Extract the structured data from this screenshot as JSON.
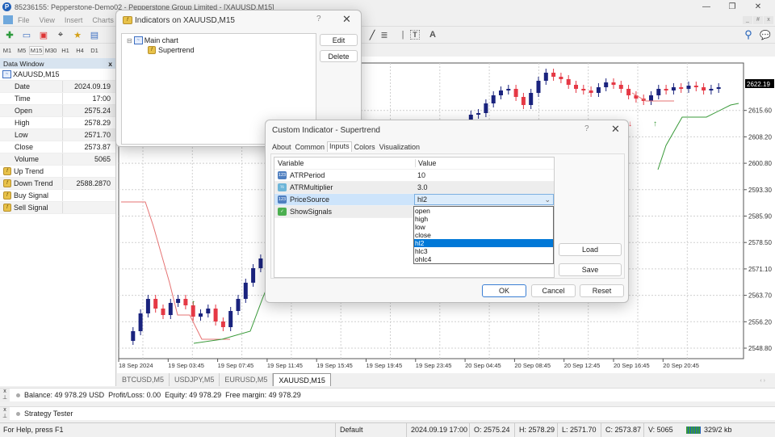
{
  "window": {
    "title": "85236155: Pepperstone-Demo02 - Pepperstone Group Limited - [XAUUSD,M15]",
    "logo": "P",
    "controls": {
      "minimize": "—",
      "restore": "❐",
      "close": "✕"
    }
  },
  "menu": [
    "File",
    "View",
    "Insert",
    "Charts"
  ],
  "mdi_controls": [
    "_",
    "#",
    "x"
  ],
  "toolbar": {
    "icons": [
      "new-chart-icon",
      "profiles-icon",
      "market-watch-icon",
      "crosshair-icon",
      "favorites-icon",
      "navigator-icon"
    ],
    "right_icons": [
      "line-icon",
      "fibonacci-icon",
      "vertical-line-icon",
      "text-icon",
      "text-label-icon"
    ],
    "glyphs": {
      "trendline": "╱",
      "fibo": "≣",
      "vline": "|",
      "text": "T",
      "label": "A",
      "search": "⚲",
      "chat": "💬"
    }
  },
  "timeframes": [
    "M1",
    "M5",
    "M15",
    "M30",
    "H1",
    "H4",
    "D1"
  ],
  "active_timeframe": "M15",
  "data_window": {
    "title": "Data Window",
    "close": "x",
    "symbol": "XAUUSD,M15",
    "rows": [
      {
        "label": "Date",
        "value": "2024.09.19"
      },
      {
        "label": "Time",
        "value": "17:00"
      },
      {
        "label": "Open",
        "value": "2575.24"
      },
      {
        "label": "High",
        "value": "2578.29"
      },
      {
        "label": "Low",
        "value": "2571.70"
      },
      {
        "label": "Close",
        "value": "2573.87"
      },
      {
        "label": "Volume",
        "value": "5065"
      }
    ],
    "indicator_rows": [
      {
        "label": "Up Trend",
        "value": ""
      },
      {
        "label": "Down Trend",
        "value": "2588.2870"
      },
      {
        "label": "Buy Signal",
        "value": ""
      },
      {
        "label": "Sell Signal",
        "value": ""
      }
    ]
  },
  "chart": {
    "symbol": "XAUUSD,M15",
    "current_price": "2622.19",
    "price_labels": [
      "2615.60",
      "2608.20",
      "2600.80",
      "2593.30",
      "2585.90",
      "2578.50",
      "2571.10",
      "2563.70",
      "2556.20",
      "2548.80"
    ],
    "time_labels": [
      "18 Sep 2024",
      "19 Sep 03:45",
      "19 Sep 07:45",
      "19 Sep 11:45",
      "19 Sep 15:45",
      "19 Sep 19:45",
      "19 Sep 23:45",
      "20 Sep 04:45",
      "20 Sep 08:45",
      "20 Sep 12:45",
      "20 Sep 16:45",
      "20 Sep 20:45"
    ],
    "colors": {
      "bull": "#1a237e",
      "bear": "#e53945",
      "up_trend": "#3a9a3a",
      "down_trend": "#e57373",
      "grid": "#d0d0d0"
    }
  },
  "chart_tabs": [
    {
      "label": "BTCUSD,M5",
      "active": false
    },
    {
      "label": "USDJPY,M5",
      "active": false
    },
    {
      "label": "EURUSD,M5",
      "active": false
    },
    {
      "label": "XAUUSD,M15",
      "active": true
    }
  ],
  "panels": {
    "balance": "Balance: 49 978.29 USD  Profit/Loss: 0.00  Equity: 49 978.29  Free margin: 49 978.29",
    "tester": "Strategy Tester"
  },
  "status": {
    "help": "For Help, press F1",
    "profile": "Default",
    "datetime": "2024.09.19 17:00",
    "open": "O: 2575.24",
    "high": "H: 2578.29",
    "low": "L: 2571.70",
    "close": "C: 2573.87",
    "volume": "V: 5065",
    "traffic": "329/2 kb"
  },
  "indicators_dialog": {
    "title": "Indicators on XAUUSD,M15",
    "help": "?",
    "close": "✕",
    "tree": {
      "root": "Main chart",
      "child": "Supertrend"
    },
    "buttons": {
      "edit": "Edit",
      "delete": "Delete"
    }
  },
  "custom_dialog": {
    "title": "Custom Indicator - Supertrend",
    "help": "?",
    "close": "✕",
    "tabs": [
      "About",
      "Common",
      "Inputs",
      "Colors",
      "Visualization"
    ],
    "active_tab": "Inputs",
    "columns": [
      "Variable",
      "Value"
    ],
    "params": [
      {
        "name": "ATRPeriod",
        "value": "10",
        "type": "int",
        "icon": "123"
      },
      {
        "name": "ATRMultiplier",
        "value": "3.0",
        "type": "double",
        "icon": "½"
      },
      {
        "name": "PriceSource",
        "value": "hl2",
        "type": "enum",
        "icon": "123"
      },
      {
        "name": "ShowSignals",
        "value": "",
        "type": "bool",
        "icon": "✓"
      }
    ],
    "dropdown_options": [
      "open",
      "high",
      "low",
      "close",
      "hl2",
      "hlc3",
      "ohlc4"
    ],
    "dropdown_selected": "hl2",
    "dropdown_arrow": "⌄",
    "buttons": {
      "load": "Load",
      "save": "Save",
      "ok": "OK",
      "cancel": "Cancel",
      "reset": "Reset"
    }
  }
}
